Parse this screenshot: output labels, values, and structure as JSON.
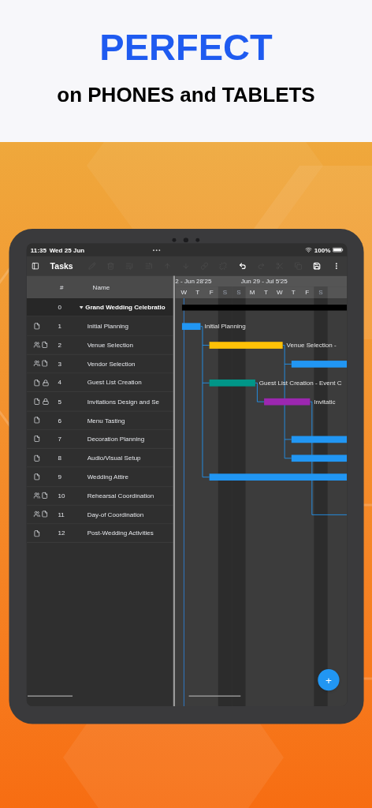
{
  "headline": {
    "title": "PERFECT",
    "subtitle": "on PHONES and TABLETS"
  },
  "status_bar": {
    "time": "11:35",
    "date": "Wed 25 Jun",
    "battery": "100%"
  },
  "toolbar": {
    "title": "Tasks",
    "tools": [
      {
        "kind": "pencil",
        "disabled": true
      },
      {
        "kind": "trash",
        "disabled": true
      },
      {
        "kind": "outdent",
        "disabled": true
      },
      {
        "kind": "indent",
        "disabled": true
      },
      {
        "kind": "up",
        "disabled": true
      },
      {
        "kind": "down",
        "disabled": true
      },
      {
        "kind": "link",
        "disabled": true
      },
      {
        "kind": "unlink",
        "disabled": true
      },
      {
        "kind": "undo",
        "disabled": false
      },
      {
        "kind": "redo",
        "disabled": true
      },
      {
        "kind": "cut",
        "disabled": true
      },
      {
        "kind": "copy",
        "disabled": true
      },
      {
        "kind": "save",
        "disabled": false
      },
      {
        "kind": "more",
        "disabled": false
      }
    ]
  },
  "table": {
    "columns": [
      "#",
      "Name"
    ],
    "rows": [
      {
        "id": "0",
        "name": "Grand Wedding Celebratio",
        "summary": true,
        "bar": {
          "color": "#000000"
        }
      },
      {
        "id": "1",
        "name": "Initial Planning",
        "kind": "file",
        "summary": false,
        "bar": {
          "color": "#2196f3",
          "label": "Initial Planning"
        }
      },
      {
        "id": "2",
        "name": "Venue Selection",
        "kind": "group-file",
        "summary": false,
        "bar": {
          "color": "#ffc107",
          "label": "Venue Selection -"
        }
      },
      {
        "id": "3",
        "name": "Vendor Selection",
        "kind": "group-file",
        "summary": false,
        "bar": {
          "color": "#2196f3"
        }
      },
      {
        "id": "4",
        "name": "Guest List Creation",
        "kind": "file-lock",
        "summary": false,
        "bar": {
          "color": "#009688",
          "label": "Guest List Creation - Event C"
        }
      },
      {
        "id": "5",
        "name": "Invitations Design and Se",
        "kind": "file-lock",
        "summary": false,
        "bar": {
          "color": "#9c27b0",
          "label": "Invitatic"
        }
      },
      {
        "id": "6",
        "name": "Menu Tasting",
        "kind": "file",
        "summary": false
      },
      {
        "id": "7",
        "name": "Decoration Planning",
        "kind": "file",
        "summary": false,
        "bar": {
          "color": "#2196f3"
        }
      },
      {
        "id": "8",
        "name": "Audio/Visual Setup",
        "kind": "file",
        "summary": false,
        "bar": {
          "color": "#2196f3"
        }
      },
      {
        "id": "9",
        "name": "Wedding Attire",
        "kind": "file",
        "summary": false,
        "bar": {
          "color": "#2196f3"
        }
      },
      {
        "id": "10",
        "name": "Rehearsal Coordination",
        "kind": "group-file",
        "summary": false
      },
      {
        "id": "11",
        "name": "Day-of Coordination",
        "kind": "group-file",
        "summary": false
      },
      {
        "id": "12",
        "name": "Post-Wedding Activities",
        "kind": "file",
        "summary": false
      }
    ]
  },
  "timeline": {
    "weeks": [
      "2 - Jun 28'25",
      "Jun 29 - Jul 5'25"
    ],
    "days": [
      {
        "label": "W",
        "weekend": false
      },
      {
        "label": "T",
        "weekend": false
      },
      {
        "label": "F",
        "weekend": false
      },
      {
        "label": "S",
        "weekend": true
      },
      {
        "label": "S",
        "weekend": true
      },
      {
        "label": "M",
        "weekend": false
      },
      {
        "label": "T",
        "weekend": false
      },
      {
        "label": "W",
        "weekend": false
      },
      {
        "label": "T",
        "weekend": false
      },
      {
        "label": "F",
        "weekend": false
      },
      {
        "label": "S",
        "weekend": true
      }
    ]
  },
  "fab": "+"
}
